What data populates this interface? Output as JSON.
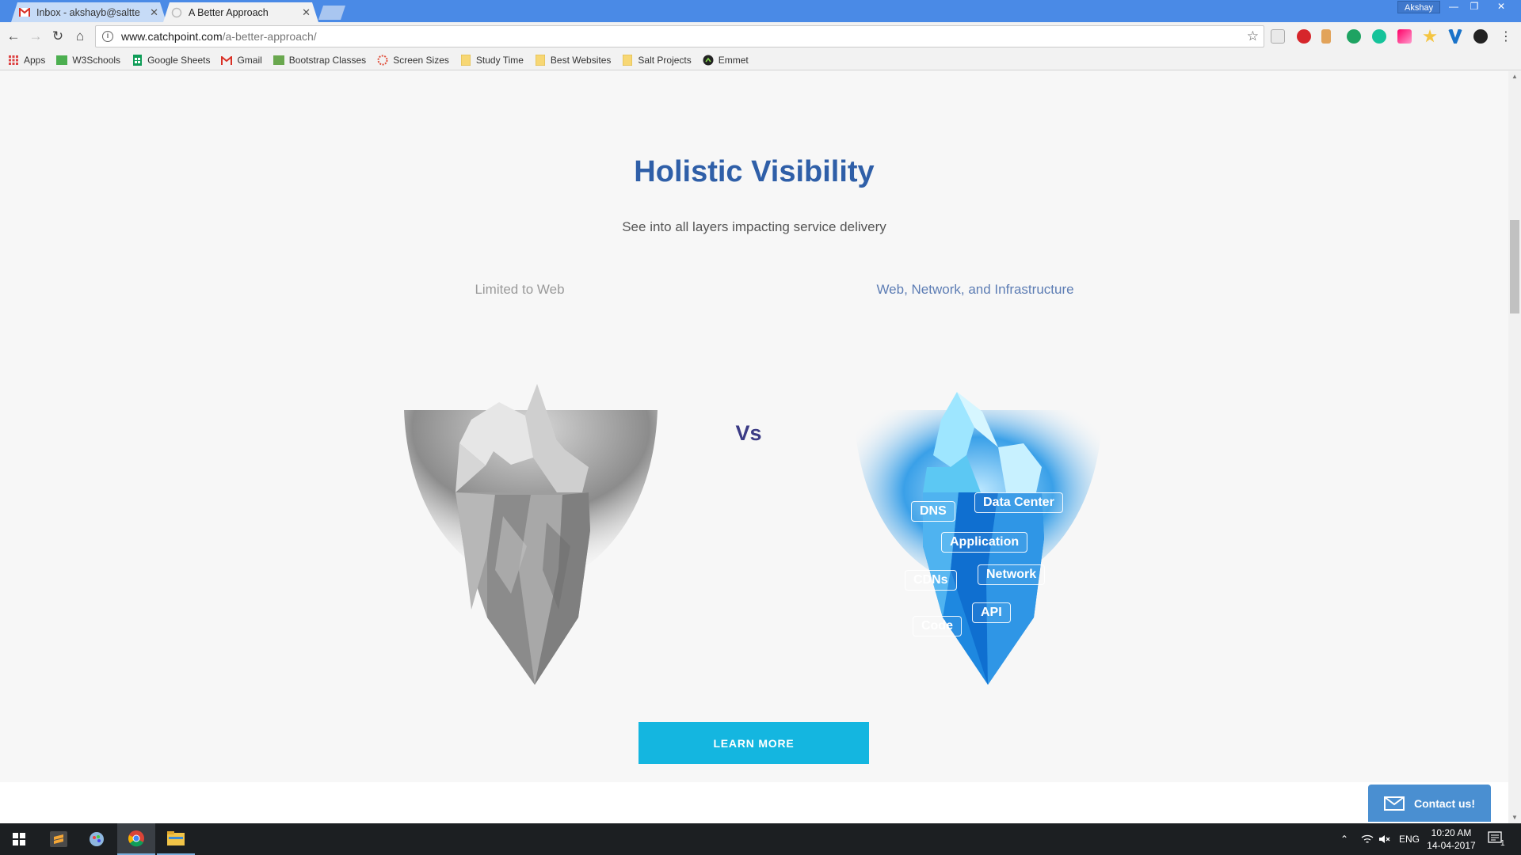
{
  "browser": {
    "tabs": [
      {
        "title": "Inbox - akshayb@saltte",
        "active": false
      },
      {
        "title": "A Better Approach",
        "active": true
      }
    ],
    "profile_name": "Akshay",
    "url_host": "www.catchpoint.com",
    "url_path": "/a-better-approach/",
    "bookmarks": [
      {
        "label": "Apps",
        "icon": "apps-grid-icon"
      },
      {
        "label": "W3Schools",
        "icon": "w3schools-icon"
      },
      {
        "label": "Google Sheets",
        "icon": "sheets-icon"
      },
      {
        "label": "Gmail",
        "icon": "gmail-icon"
      },
      {
        "label": "Bootstrap Classes",
        "icon": "bootstrap-icon"
      },
      {
        "label": "Screen Sizes",
        "icon": "screen-sizes-icon"
      },
      {
        "label": "Study Time",
        "icon": "folder-icon"
      },
      {
        "label": "Best Websites",
        "icon": "folder-icon"
      },
      {
        "label": "Salt Projects",
        "icon": "folder-icon"
      },
      {
        "label": "Emmet",
        "icon": "emmet-icon"
      }
    ]
  },
  "page": {
    "title": "Holistic Visibility",
    "subtitle": "See into all layers impacting service delivery",
    "left_label": "Limited to Web",
    "right_label": "Web, Network, and Infrastructure",
    "vs": "Vs",
    "iceberg_tags": [
      "DNS",
      "Data Center",
      "Application",
      "CDNs",
      "Network",
      "API",
      "Code"
    ],
    "cta": "LEARN MORE",
    "contact": "Contact us!"
  },
  "taskbar": {
    "language": "ENG",
    "time": "10:20 AM",
    "date": "14-04-2017",
    "notification_count": "1"
  },
  "colors": {
    "title_blue": "#2f5fa8",
    "cta_cyan": "#14b6e0",
    "contact_blue": "#4a8fd1",
    "chrome_blue": "#4a8ae6"
  }
}
